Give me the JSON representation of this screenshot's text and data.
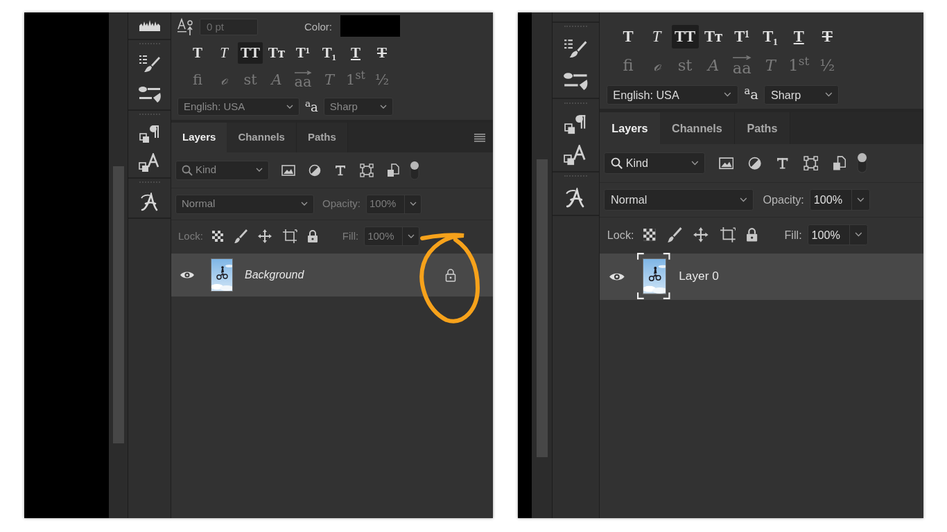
{
  "panels": [
    {
      "character": {
        "size_field": {
          "value": "0 pt",
          "disabled": true
        },
        "color_label": "Color:"
      },
      "style_buttons": [
        {
          "label": "T",
          "kind": "bold",
          "selected": false
        },
        {
          "label": "T",
          "kind": "italic",
          "selected": false
        },
        {
          "label": "TT",
          "kind": "all_caps",
          "selected": true
        },
        {
          "label": "Tᴛ",
          "kind": "small_caps",
          "selected": false
        },
        {
          "label": "T¹",
          "kind": "superscript",
          "selected": false
        },
        {
          "label": "T₁",
          "kind": "subscript",
          "selected": false
        },
        {
          "label": "T",
          "kind": "underline",
          "selected": false
        },
        {
          "label": "T",
          "kind": "strikethrough",
          "selected": false
        }
      ],
      "opentype_buttons": [
        {
          "label": "fi",
          "kind": "ligature",
          "disabled": true
        },
        {
          "label": "ℴ",
          "kind": "ornament",
          "disabled": true
        },
        {
          "label": "st",
          "kind": "discretionary",
          "disabled": true
        },
        {
          "label": "A",
          "kind": "swash",
          "disabled": true
        },
        {
          "label": "aa",
          "kind": "titling",
          "disabled": true
        },
        {
          "label": "T",
          "kind": "stylistic",
          "disabled": true
        },
        {
          "label": "1$^{st}$",
          "kind": "ordinal",
          "disabled": true
        },
        {
          "label": "½",
          "kind": "fraction",
          "disabled": true
        }
      ],
      "language": {
        "value": "English: USA",
        "disabled": true
      },
      "antialias_icon": "$^{a}$a",
      "antialias": {
        "value": "Sharp",
        "disabled": true
      },
      "tabs": [
        {
          "label": "Layers",
          "selected": true
        },
        {
          "label": "Channels",
          "selected": false
        },
        {
          "label": "Paths",
          "selected": false
        }
      ],
      "panel_menu": true,
      "filter": {
        "value": "Kind",
        "disabled": true
      },
      "blend_mode": {
        "value": "Normal",
        "disabled": true
      },
      "opacity_label": "Opacity:",
      "opacity": {
        "value": "100%",
        "disabled": true
      },
      "lock_label": "Lock:",
      "fill_label": "Fill:",
      "fill": {
        "value": "100%",
        "disabled": true
      },
      "layers": [
        {
          "name": "Background",
          "kind": "background",
          "selected": true,
          "visible": true,
          "locked": true,
          "thumbnail_active": false,
          "circled": true
        }
      ]
    },
    {
      "style_buttons": [
        {
          "label": "T",
          "kind": "bold",
          "selected": false
        },
        {
          "label": "T",
          "kind": "italic",
          "selected": false
        },
        {
          "label": "TT",
          "kind": "all_caps",
          "selected": true
        },
        {
          "label": "Tᴛ",
          "kind": "small_caps",
          "selected": false
        },
        {
          "label": "T¹",
          "kind": "superscript",
          "selected": false
        },
        {
          "label": "T₁",
          "kind": "subscript",
          "selected": false
        },
        {
          "label": "T",
          "kind": "underline",
          "selected": false
        },
        {
          "label": "T",
          "kind": "strikethrough",
          "selected": false
        }
      ],
      "opentype_buttons": [
        {
          "label": "fi",
          "kind": "ligature",
          "disabled": true
        },
        {
          "label": "ℴ",
          "kind": "ornament",
          "disabled": true
        },
        {
          "label": "st",
          "kind": "discretionary",
          "disabled": true
        },
        {
          "label": "A",
          "kind": "swash",
          "disabled": true
        },
        {
          "label": "aa",
          "kind": "titling",
          "disabled": true
        },
        {
          "label": "T",
          "kind": "stylistic",
          "disabled": true
        },
        {
          "label": "1$^{st}$",
          "kind": "ordinal",
          "disabled": true
        },
        {
          "label": "½",
          "kind": "fraction",
          "disabled": true
        }
      ],
      "language": {
        "value": "English: USA",
        "disabled": false
      },
      "antialias_icon": "$^{a}$a",
      "antialias": {
        "value": "Sharp",
        "disabled": false
      },
      "tabs": [
        {
          "label": "Layers",
          "selected": true
        },
        {
          "label": "Channels",
          "selected": false
        },
        {
          "label": "Paths",
          "selected": false
        }
      ],
      "panel_menu": false,
      "filter": {
        "value": "Kind",
        "disabled": false
      },
      "blend_mode": {
        "value": "Normal",
        "disabled": false
      },
      "opacity_label": "Opacity:",
      "opacity": {
        "value": "100%",
        "disabled": false
      },
      "lock_label": "Lock:",
      "fill_label": "Fill:",
      "fill": {
        "value": "100%",
        "disabled": false
      },
      "layers": [
        {
          "name": "Layer 0",
          "kind": "normal",
          "selected": true,
          "visible": true,
          "locked": false,
          "thumbnail_active": true,
          "circled": false
        }
      ]
    }
  ]
}
